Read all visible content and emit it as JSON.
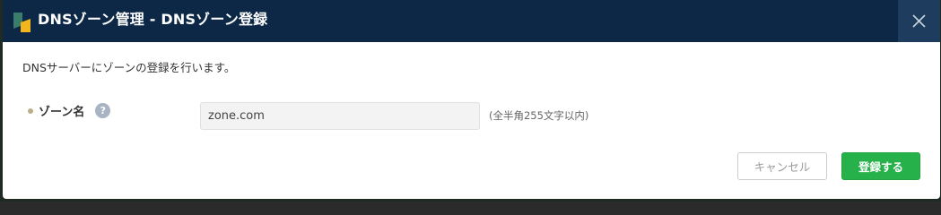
{
  "dialog": {
    "title": "DNSゾーン管理 - DNSゾーン登録",
    "logo_icon": "app-logo-icon",
    "close_icon": "close-icon"
  },
  "form": {
    "description": "DNSサーバーにゾーンの登録を行います。",
    "zone_name": {
      "label": "ゾーン名",
      "help_icon": "help-icon",
      "help_glyph": "?",
      "value": "zone.com",
      "hint": "(全半角255文字以内)"
    }
  },
  "buttons": {
    "cancel_label": "キャンセル",
    "submit_label": "登録する"
  },
  "colors": {
    "titlebar": "#0d2746",
    "close_button": "#1e3d5e",
    "submit": "#27b14b",
    "logo_green": "#3a7d6a",
    "logo_yellow": "#f2b51b"
  }
}
